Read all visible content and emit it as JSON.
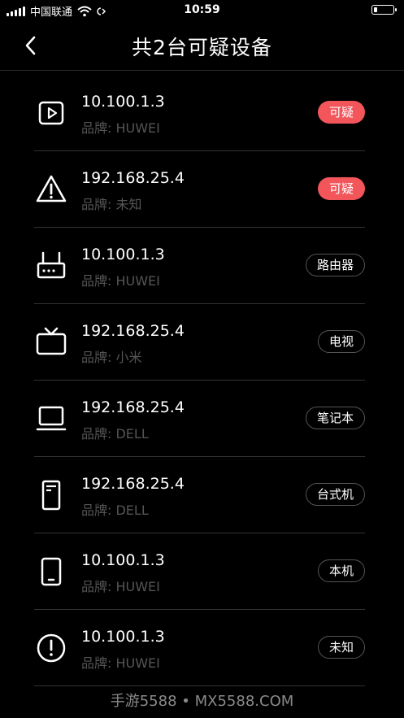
{
  "status_bar": {
    "carrier": "中国联通",
    "time": "10:59",
    "battery_level": 0.2
  },
  "header": {
    "title": "共2台可疑设备"
  },
  "devices": [
    {
      "ip": "10.100.1.3",
      "brand": "品牌: HUWEI",
      "tag": "可疑",
      "tag_style": "danger",
      "icon": "play-icon"
    },
    {
      "ip": "192.168.25.4",
      "brand": "品牌: 未知",
      "tag": "可疑",
      "tag_style": "danger",
      "icon": "warning-icon"
    },
    {
      "ip": "10.100.1.3",
      "brand": "品牌: HUWEI",
      "tag": "路由器",
      "tag_style": "outline",
      "icon": "router-icon"
    },
    {
      "ip": "192.168.25.4",
      "brand": "品牌: 小米",
      "tag": "电视",
      "tag_style": "outline",
      "icon": "tv-icon"
    },
    {
      "ip": "192.168.25.4",
      "brand": "品牌: DELL",
      "tag": "笔记本",
      "tag_style": "outline",
      "icon": "laptop-icon"
    },
    {
      "ip": "192.168.25.4",
      "brand": "品牌: DELL",
      "tag": "台式机",
      "tag_style": "outline",
      "icon": "desktop-icon"
    },
    {
      "ip": "10.100.1.3",
      "brand": "品牌: HUWEI",
      "tag": "本机",
      "tag_style": "outline",
      "icon": "phone-icon"
    },
    {
      "ip": "10.100.1.3",
      "brand": "品牌: HUWEI",
      "tag": "未知",
      "tag_style": "outline",
      "icon": "exclamation-circle-icon"
    }
  ],
  "watermark": "手游5588 • MX5588.COM",
  "colors": {
    "danger": "#f2555a",
    "background": "#000000",
    "brand_text": "#555555"
  }
}
